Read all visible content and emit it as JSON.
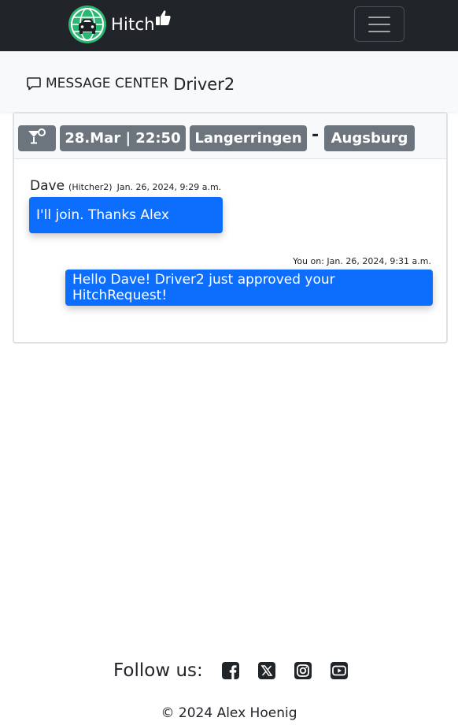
{
  "navbar": {
    "brand_text": "Hitch",
    "logo_icon": "car-globe-logo-icon",
    "thumb_icon": "thumbs-up-icon",
    "menu_icon": "hamburger-menu-icon"
  },
  "header": {
    "icon": "chat-bubble-icon",
    "label": "MESSAGE CENTER",
    "driver": "Driver2"
  },
  "ride": {
    "type_icon": "cocktail-glass-icon",
    "datetime": "28.Mar | 22:50",
    "from": "Langerringen",
    "separator": "-",
    "to": "Augsburg"
  },
  "messages": [
    {
      "sender": "Dave",
      "handle": "(Hitcher2)",
      "time": "Jan. 26, 2024, 9:29 a.m.",
      "text": "I'll join. Thanks Alex"
    },
    {
      "time_label": "You on: Jan. 26, 2024, 9:31 a.m.",
      "text": "Hello Dave! Driver2 just approved your HitchRequest!"
    }
  ],
  "footer": {
    "follow_label": "Follow us:",
    "social": [
      "facebook-icon",
      "x-twitter-icon",
      "instagram-icon",
      "youtube-icon"
    ],
    "copyright": "© 2024 Alex Hoenig"
  },
  "colors": {
    "navbar": "#212529",
    "bubble": "#0d6efd",
    "badge": "#6c757d",
    "logo": "#2bb673"
  }
}
